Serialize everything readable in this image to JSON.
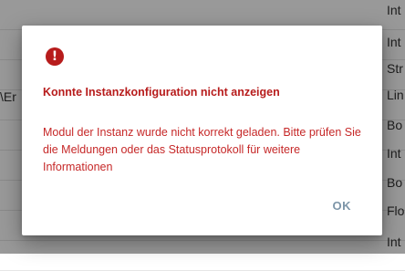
{
  "background": {
    "left_text": "\\Er",
    "type_column": [
      "Int",
      "Int",
      "Str",
      "Lin",
      "Bo",
      "Int",
      "Bo",
      "Flo",
      "Int"
    ]
  },
  "dialog": {
    "icon": "error-icon",
    "title": "Konnte Instanzkonfiguration nicht anzeigen",
    "message": "Modul der Instanz wurde nicht korrekt geladen. Bitte prüfen Sie die Meldungen oder das Statusprotokoll für weitere Informationen",
    "ok_label": "OK",
    "colors": {
      "error": "#b71c1c",
      "message": "#c62828",
      "ok": "#7d95a8"
    }
  }
}
